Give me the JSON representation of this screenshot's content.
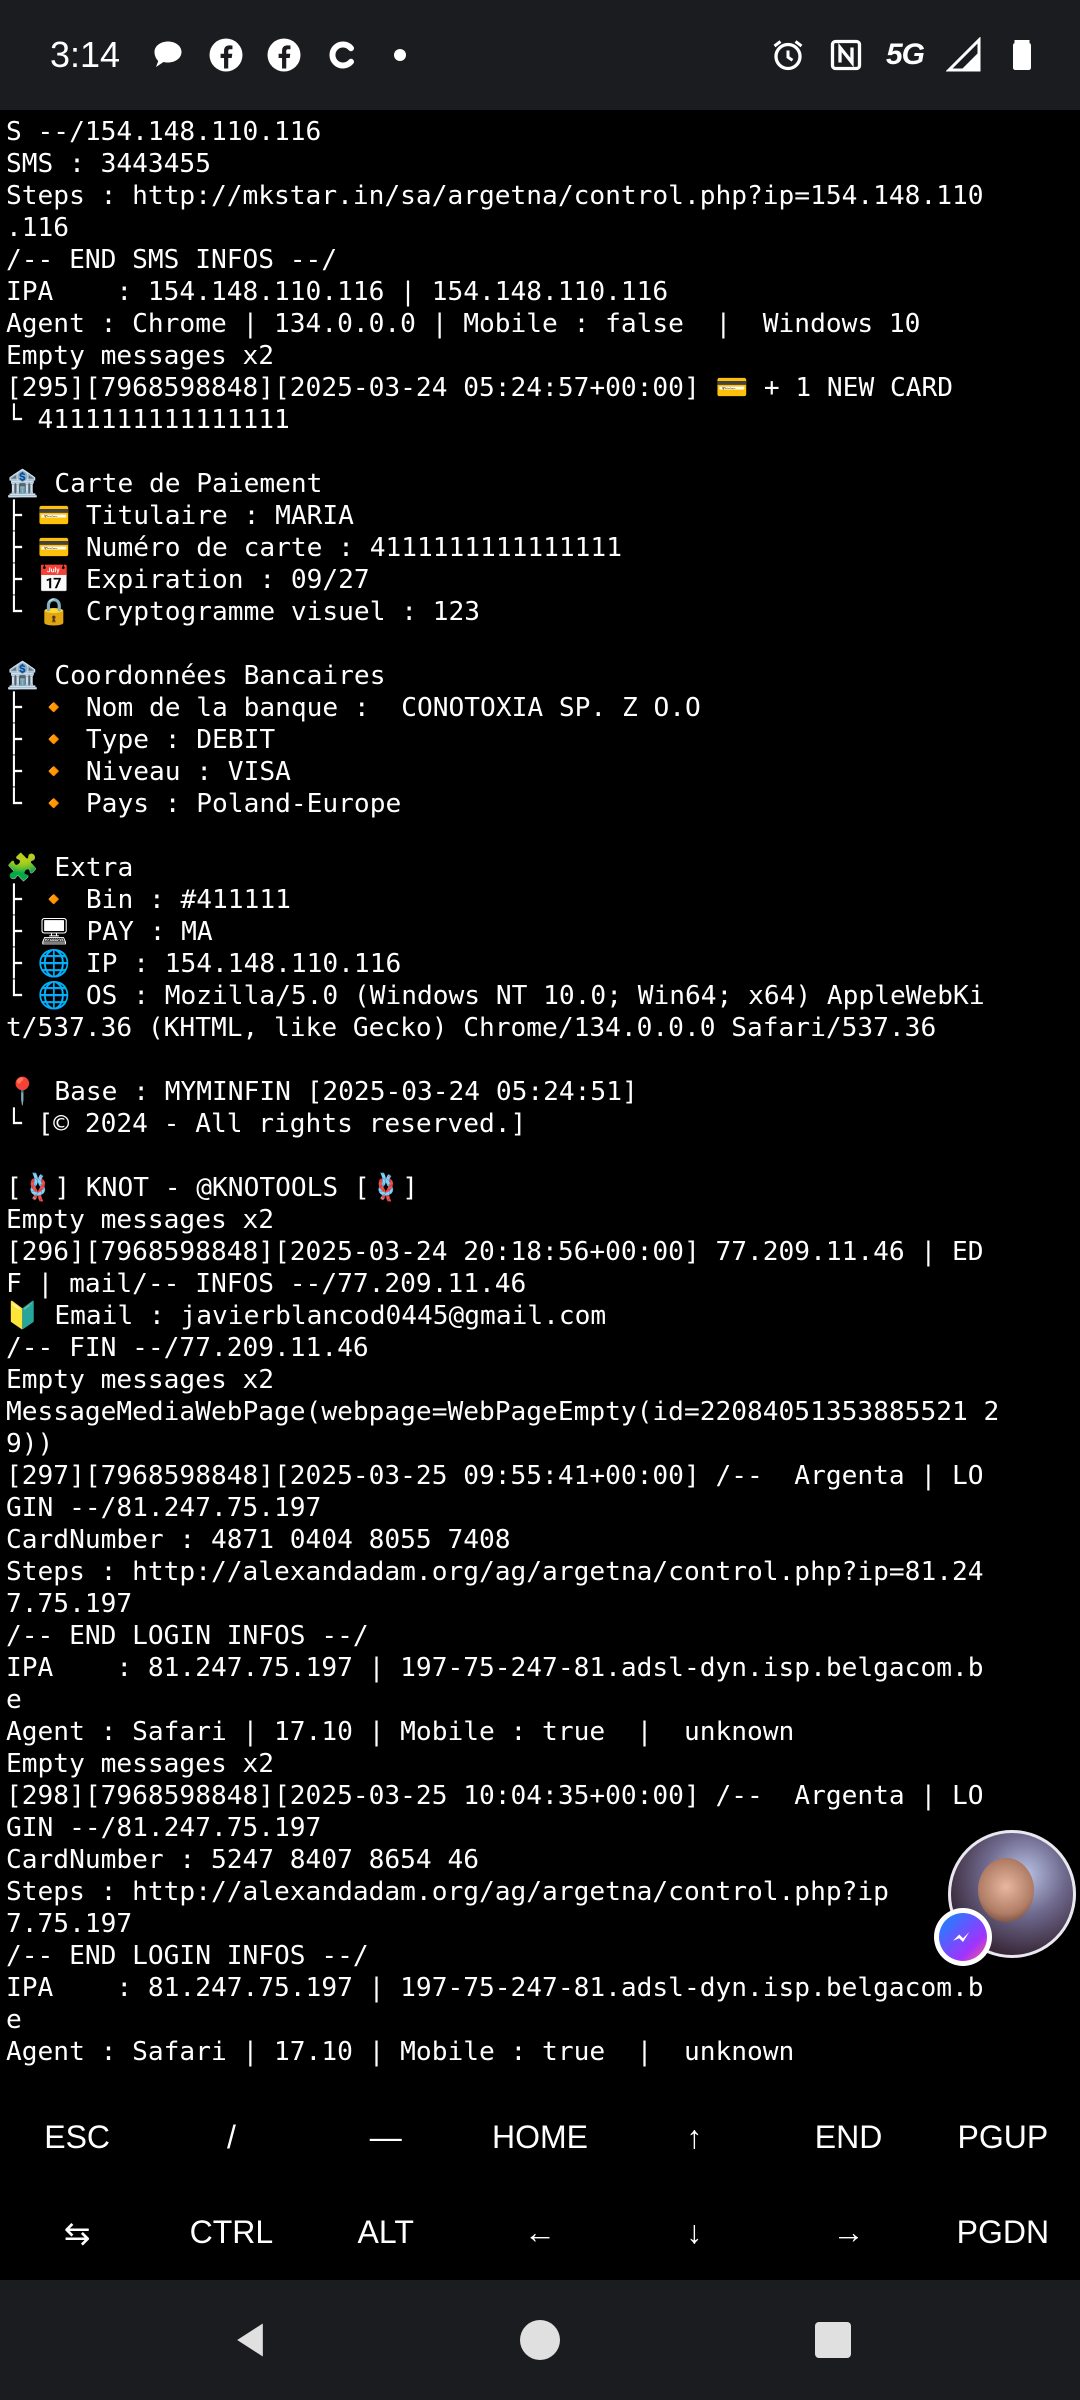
{
  "status_bar": {
    "time": "3:14",
    "network": "5G",
    "left_icons": [
      "chat-bubble-icon",
      "facebook-icon",
      "facebook-icon",
      "c-app-icon",
      "dot-icon"
    ],
    "right_icons": [
      "alarm-icon",
      "nfc-icon",
      "signal-icon",
      "battery-icon"
    ]
  },
  "terminal": {
    "lines": [
      "S --/154.148.110.116",
      "SMS : 3443455",
      "Steps : http://mkstar.in/sa/argetna/control.php?ip=154.148.110",
      ".116",
      "/-- END SMS INFOS --/",
      "IPA    : 154.148.110.116 | 154.148.110.116",
      "Agent : Chrome | 134.0.0.0 | Mobile : false  |  Windows 10",
      "Empty messages x2",
      "[295][7968598848][2025-03-24 05:24:57+00:00] 💳 + 1 NEW CARD",
      "└ 4111111111111111",
      "",
      "🏦 Carte de Paiement",
      "├ 💳 Titulaire : MARIA",
      "├ 💳 Numéro de carte : 4111111111111111",
      "├ 📅 Expiration : 09/27",
      "└ 🔒 Cryptogramme visuel : 123",
      "",
      "🏦 Coordonnées Bancaires",
      "├ 🔸 Nom de la banque :  CONOTOXIA SP. Z O.O",
      "├ 🔸 Type : DEBIT",
      "├ 🔸 Niveau : VISA",
      "└ 🔸 Pays : Poland-Europe",
      "",
      "🧩 Extra",
      "├ 🔸 Bin : #411111",
      "├ 🖥 PAY : MA",
      "├ 🌐 IP : 154.148.110.116",
      "└ 🌐 OS : Mozilla/5.0 (Windows NT 10.0; Win64; x64) AppleWebKi",
      "t/537.36 (KHTML, like Gecko) Chrome/134.0.0.0 Safari/537.36",
      "",
      "📍 Base : MYMINFIN [2025-03-24 05:24:51]",
      "└ [© 2024 - All rights reserved.]",
      "",
      "[🪢] KNOT - @KNOTOOLS [🪢]",
      "Empty messages x2",
      "[296][7968598848][2025-03-24 20:18:56+00:00] 77.209.11.46 | ED",
      "F | mail/-- INFOS --/77.209.11.46",
      "🔰 Email : javierblancod0445@gmail.com",
      "/-- FIN --/77.209.11.46",
      "Empty messages x2",
      "MessageMediaWebPage(webpage=WebPageEmpty(id=22084051353885521 2",
      "9))",
      "[297][7968598848][2025-03-25 09:55:41+00:00] /--  Argenta | LO",
      "GIN --/81.247.75.197",
      "CardNumber : 4871 0404 8055 7408",
      "Steps : http://alexandadam.org/ag/argetna/control.php?ip=81.24",
      "7.75.197",
      "/-- END LOGIN INFOS --/",
      "IPA    : 81.247.75.197 | 197-75-247-81.adsl-dyn.isp.belgacom.b",
      "e",
      "Agent : Safari | 17.10 | Mobile : true  |  unknown",
      "Empty messages x2",
      "[298][7968598848][2025-03-25 10:04:35+00:00] /--  Argenta | LO",
      "GIN --/81.247.75.197",
      "CardNumber : 5247 8407 8654 46",
      "Steps : http://alexandadam.org/ag/argetna/control.php?ip",
      "7.75.197",
      "/-- END LOGIN INFOS --/",
      "IPA    : 81.247.75.197 | 197-75-247-81.adsl-dyn.isp.belgacom.b",
      "e",
      "Agent : Safari | 17.10 | Mobile : true  |  unknown"
    ]
  },
  "extra_keys": {
    "row1": [
      "ESC",
      "/",
      "—",
      "HOME",
      "↑",
      "END",
      "PGUP"
    ],
    "row2": [
      "⇆",
      "CTRL",
      "ALT",
      "←",
      "↓",
      "→",
      "PGDN"
    ]
  },
  "nav_bar": {
    "icons": [
      "back-icon",
      "home-icon",
      "recents-icon"
    ]
  }
}
